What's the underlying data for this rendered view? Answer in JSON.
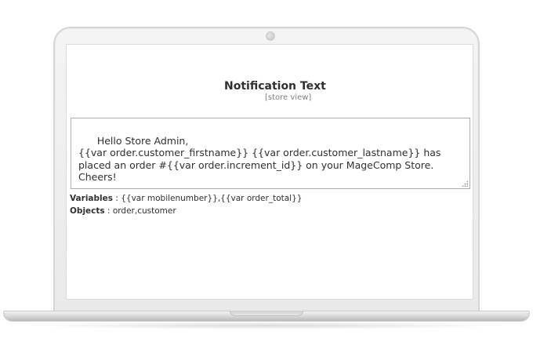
{
  "notification": {
    "title": "Notification Text",
    "scope": "[store view]",
    "body": "Hello Store Admin,\n{{var order.customer_firstname}} {{var order.customer_lastname}} has placed an order #{{var order.increment_id}} on your MageComp Store.\nCheers!"
  },
  "variables": {
    "label": "Variables",
    "separator": " : ",
    "value": "{{var mobilenumber}},{{var order_total}}"
  },
  "objects": {
    "label": "Objects",
    "separator": " : ",
    "value": "order,customer"
  },
  "icons": {
    "camera": "webcam-dot",
    "resize": "resize-grip-icon"
  }
}
